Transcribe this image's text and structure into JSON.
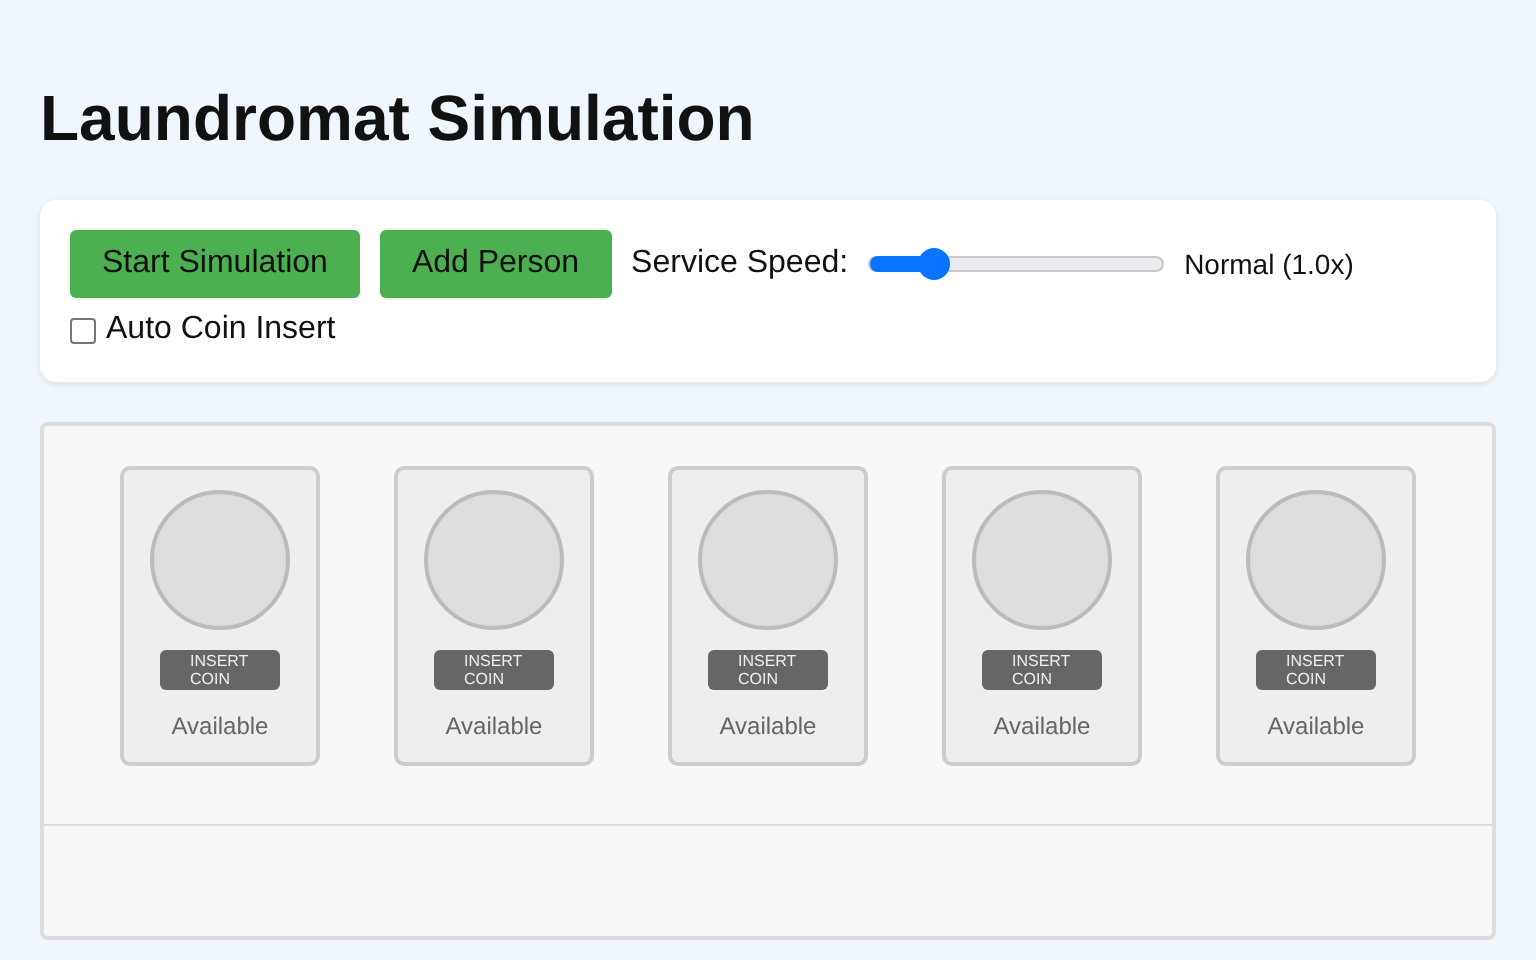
{
  "title": "Laundromat Simulation",
  "controls": {
    "buttons": [
      "Start Simulation",
      "Add Person"
    ],
    "speed": {
      "label": "Service Speed:",
      "level": 0.22,
      "reading": "Normal (1.0x)"
    },
    "auto_coin": {
      "label": "Auto Coin Insert",
      "checked": false
    }
  },
  "machines": [
    {
      "coin_button": "INSERT COIN",
      "status": "Available"
    },
    {
      "coin_button": "INSERT COIN",
      "status": "Available"
    },
    {
      "coin_button": "INSERT COIN",
      "status": "Available"
    },
    {
      "coin_button": "INSERT COIN",
      "status": "Available"
    },
    {
      "coin_button": "INSERT COIN",
      "status": "Available"
    }
  ]
}
